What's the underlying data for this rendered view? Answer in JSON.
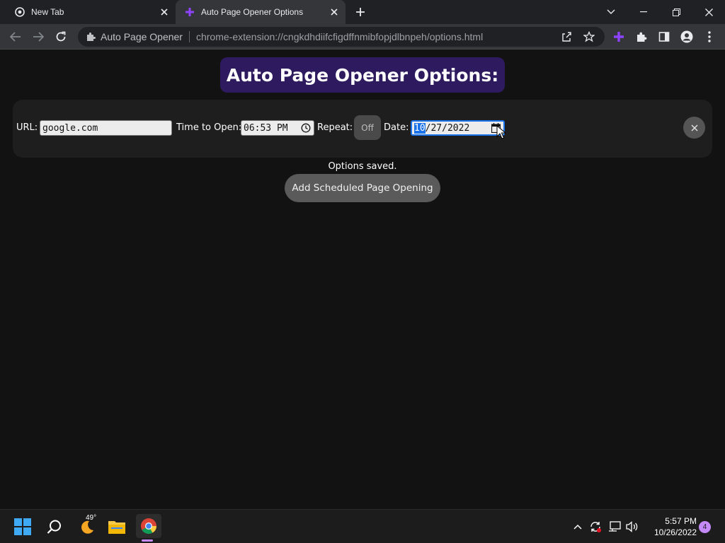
{
  "browser": {
    "tabs": [
      {
        "title": "New Tab",
        "active": false,
        "icon": "chrome-icon"
      },
      {
        "title": "Auto Page Opener Options",
        "active": true,
        "icon": "extension-plus-icon"
      }
    ],
    "omnibox": {
      "site_label": "Auto Page Opener",
      "url": "chrome-extension://cngkdhdiifcfigdffnmibfopjdlbnpeh/options.html"
    }
  },
  "page": {
    "title": "Auto Page Opener Options:",
    "row": {
      "url_label": "URL:",
      "url_value": "google.com",
      "time_label": "Time to Open:",
      "time_value": "06:53 PM",
      "repeat_label": "Repeat:",
      "repeat_value": "Off",
      "date_label": "Date:",
      "date_month": "10",
      "date_rest": "/27/2022"
    },
    "status": "Options saved.",
    "add_button": "Add Scheduled Page Opening"
  },
  "taskbar": {
    "weather_temp": "49°",
    "clock_time": "5:57 PM",
    "clock_date": "10/26/2022",
    "notification_count": "4"
  },
  "colors": {
    "title_bg": "#2e1a5e",
    "accent": "#1a73e8",
    "page_bg": "#121212"
  }
}
